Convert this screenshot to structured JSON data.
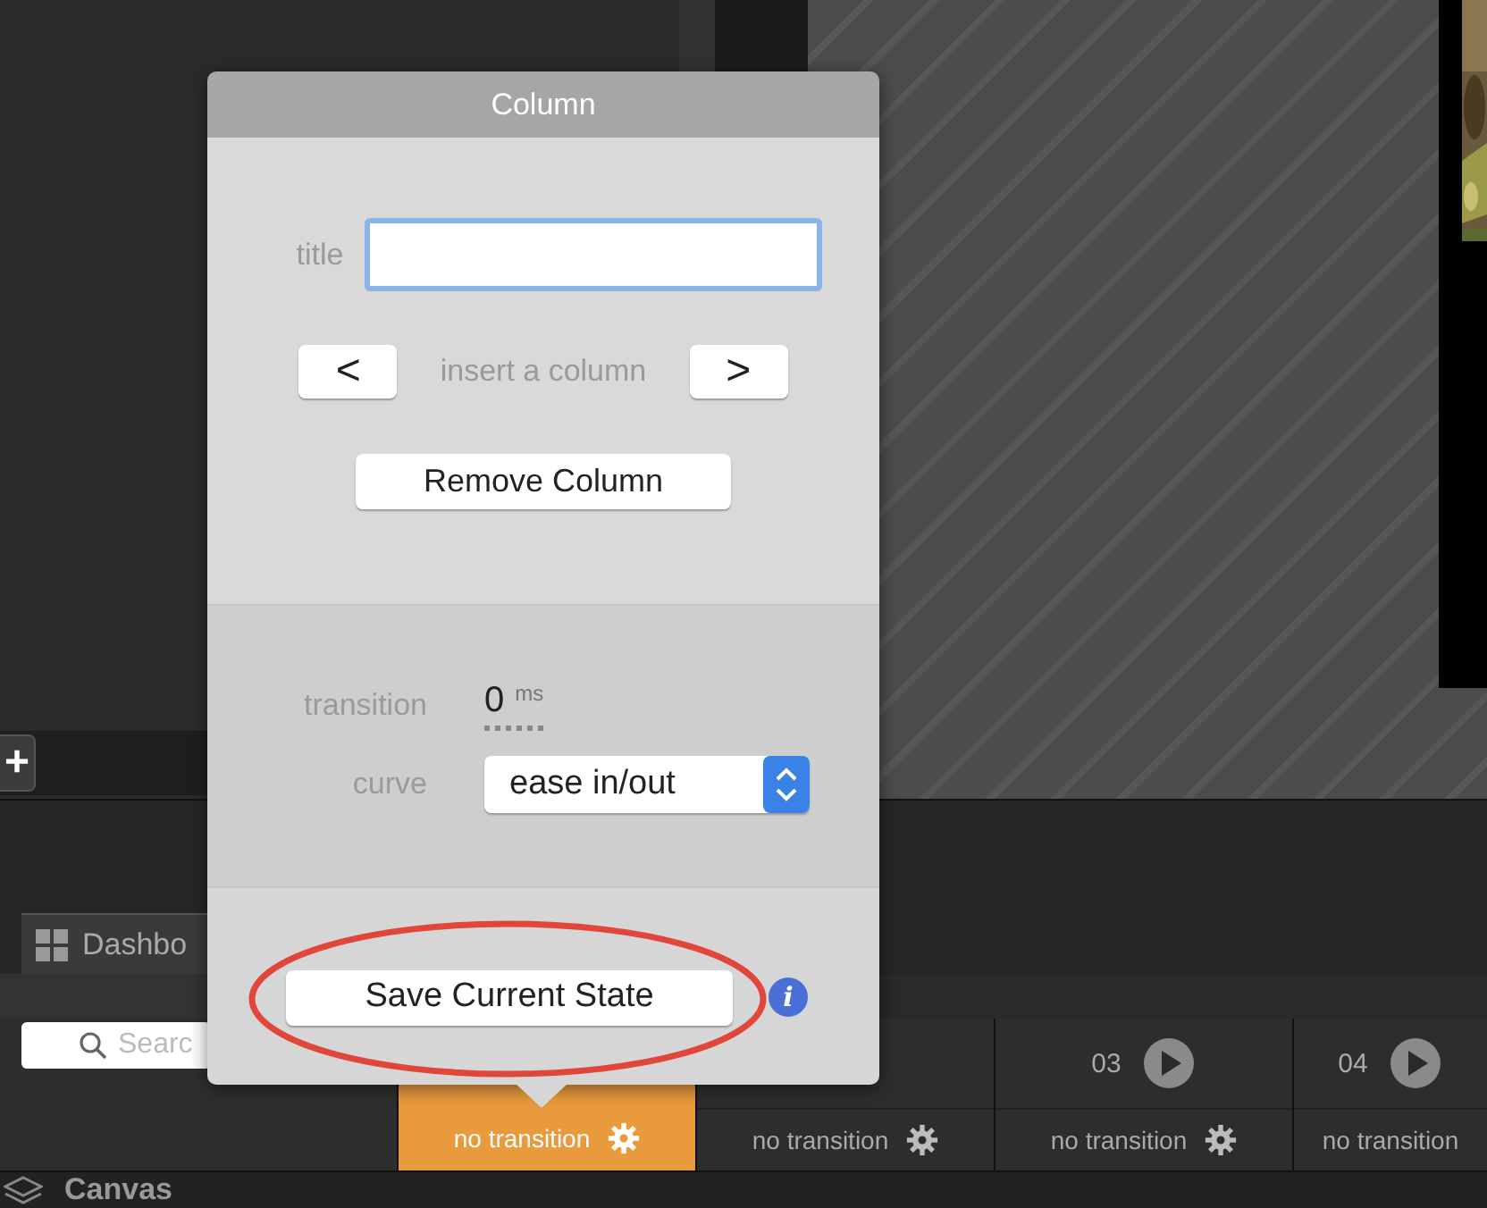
{
  "popover": {
    "title": "Column",
    "title_field": {
      "label": "title",
      "focused": true
    },
    "insert": {
      "prev": "<",
      "label": "insert a column",
      "next": ">"
    },
    "remove_button": "Remove Column",
    "transition": {
      "label": "transition",
      "value": "0",
      "unit": "ms"
    },
    "curve": {
      "label": "curve",
      "value": "ease in/out"
    },
    "save_button": "Save Current State",
    "info": "i"
  },
  "add_button": "+",
  "tabs": [
    {
      "label": "Dashbo",
      "selected": true
    }
  ],
  "search": {
    "placeholder": "Searc"
  },
  "timeline": [
    {
      "transition": "no transition",
      "selected": true,
      "settings_icon": true
    },
    {
      "transition": "no transition",
      "selected": false,
      "settings_icon": true
    },
    {
      "number": "03",
      "transition": "no transition",
      "selected": false,
      "settings_icon": true
    },
    {
      "number": "04",
      "transition": "no transition",
      "selected": false,
      "settings_icon": false
    }
  ],
  "layers": {
    "label": "Canvas"
  }
}
